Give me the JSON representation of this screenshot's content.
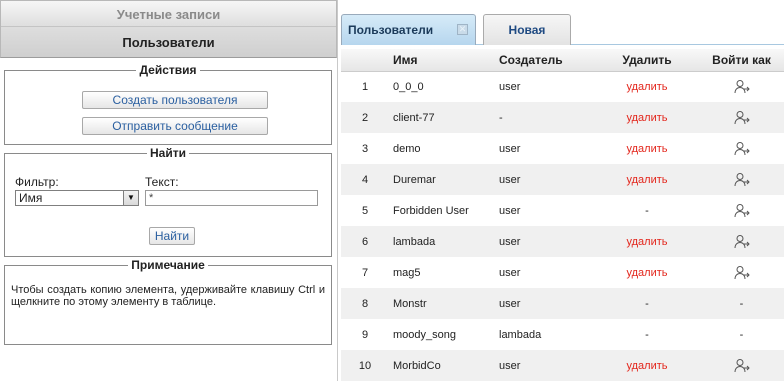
{
  "left_panel": {
    "section_title": "Учетные записи",
    "subtitle": "Пользователи",
    "actions": {
      "legend": "Действия",
      "create_user": "Создать пользователя",
      "send_message": "Отправить сообщение"
    },
    "find": {
      "legend": "Найти",
      "filter_label": "Фильтр:",
      "filter_value": "Имя",
      "text_label": "Текст:",
      "text_value": "*",
      "find_button": "Найти"
    },
    "note": {
      "legend": "Примечание",
      "text": "Чтобы создать копию элемента, удерживайте клавишу Ctrl и щелкните по этому элементу в таблице."
    }
  },
  "tabs": [
    {
      "label": "Пользователи"
    },
    {
      "label": "Новая"
    }
  ],
  "table": {
    "headers": {
      "num": "",
      "name": "Имя",
      "creator": "Создатель",
      "delete": "Удалить",
      "login_as": "Войти как"
    },
    "rows": [
      {
        "num": "1",
        "name": "0_0_0",
        "creator": "user",
        "delete": "удалить",
        "login_as": true
      },
      {
        "num": "2",
        "name": "client-77",
        "creator": "-",
        "delete": "удалить",
        "login_as": true
      },
      {
        "num": "3",
        "name": "demo",
        "creator": "user",
        "delete": "удалить",
        "login_as": true
      },
      {
        "num": "4",
        "name": "Duremar",
        "creator": "user",
        "delete": "удалить",
        "login_as": true
      },
      {
        "num": "5",
        "name": "Forbidden User",
        "creator": "user",
        "delete": "-",
        "login_as": true
      },
      {
        "num": "6",
        "name": "lambada",
        "creator": "user",
        "delete": "удалить",
        "login_as": true
      },
      {
        "num": "7",
        "name": "mag5",
        "creator": "user",
        "delete": "удалить",
        "login_as": true
      },
      {
        "num": "8",
        "name": "Monstr",
        "creator": "user",
        "delete": "-",
        "login_as": false
      },
      {
        "num": "9",
        "name": "moody_song",
        "creator": "lambada",
        "delete": "-",
        "login_as": false
      },
      {
        "num": "10",
        "name": "MorbidCo",
        "creator": "user",
        "delete": "удалить",
        "login_as": true
      }
    ]
  },
  "icons": {
    "close_tab": "close-icon",
    "login_as": "user-login-icon",
    "dropdown": "chevron-down-icon"
  },
  "colors": {
    "delete_link": "#e3261c",
    "tab_active": "#b6d6ee",
    "link_text": "#2a5fa0"
  }
}
